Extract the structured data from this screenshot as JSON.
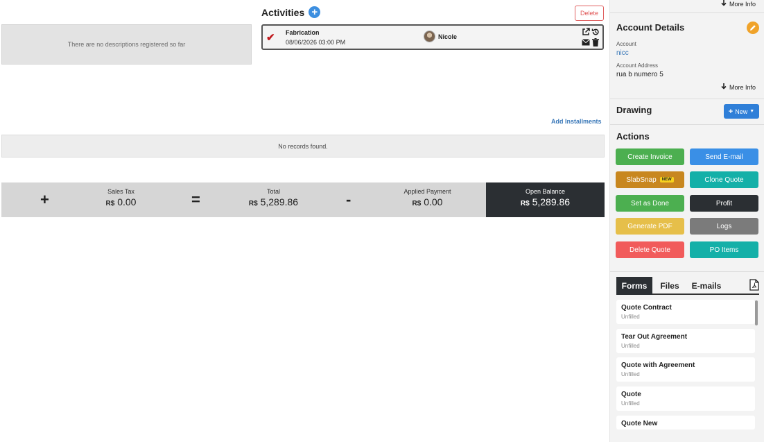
{
  "description": {
    "empty_text": "There are no descriptions registered so far"
  },
  "activities": {
    "title": "Activities",
    "delete_label": "Delete",
    "items": [
      {
        "name": "Fabrication",
        "date": "08/06/2026 03:00 PM",
        "user": "Nicole"
      }
    ]
  },
  "installments": {
    "add_label": "Add Installments",
    "empty_text": "No records found."
  },
  "totals": {
    "currency": "R$",
    "sales_tax": {
      "label": "Sales Tax",
      "value": "0.00"
    },
    "total": {
      "label": "Total",
      "value": "5,289.86"
    },
    "applied_payment": {
      "label": "Applied Payment",
      "value": "0.00"
    },
    "open_balance": {
      "label": "Open Balance",
      "value": "5,289.86"
    },
    "ops": {
      "plus": "+",
      "equals": "=",
      "minus": "-"
    }
  },
  "sidebar": {
    "more_info_top": "More Info",
    "account_details": {
      "title": "Account Details",
      "account_label": "Account",
      "account_value": "nicc",
      "address_label": "Account Address",
      "address_value": "rua b numero 5",
      "more_info": "More Info"
    },
    "drawing": {
      "title": "Drawing",
      "new_label": "New"
    },
    "actions": {
      "title": "Actions",
      "buttons": [
        {
          "label": "Create Invoice",
          "color": "#4caf50"
        },
        {
          "label": "Send E-mail",
          "color": "#3a8fe6"
        },
        {
          "label": "SlabSnap",
          "color": "#c8871f",
          "badge": "NEW"
        },
        {
          "label": "Clone Quote",
          "color": "#14b0a8"
        },
        {
          "label": "Set as Done",
          "color": "#4caf50"
        },
        {
          "label": "Profit",
          "color": "#2b2f33"
        },
        {
          "label": "Generate PDF",
          "color": "#e6bf4a"
        },
        {
          "label": "Logs",
          "color": "#7b7b7b"
        },
        {
          "label": "Delete Quote",
          "color": "#f15b5b"
        },
        {
          "label": "PO Items",
          "color": "#14b0a8"
        }
      ]
    },
    "tabs": [
      "Forms",
      "Files",
      "E-mails"
    ],
    "forms": [
      {
        "name": "Quote Contract",
        "status": "Unfilled"
      },
      {
        "name": "Tear Out Agreement",
        "status": "Unfilled"
      },
      {
        "name": "Quote with Agreement",
        "status": "Unfilled"
      },
      {
        "name": "Quote",
        "status": "Unfilled"
      },
      {
        "name": "Quote New",
        "status": ""
      }
    ]
  }
}
